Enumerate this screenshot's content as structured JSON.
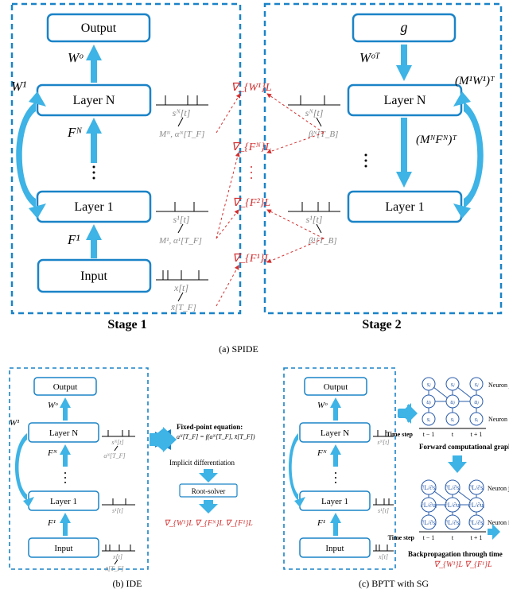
{
  "a": {
    "caption": "(a) SPIDE",
    "stage1_label": "Stage 1",
    "stage2_label": "Stage 2",
    "left": {
      "output": "Output",
      "layerN": "Layer N",
      "layer1": "Layer 1",
      "input": "Input",
      "Wo": "Wᵒ",
      "W1": "W¹",
      "FN": "Fᴺ",
      "F1": "F¹"
    },
    "right": {
      "g": "g",
      "layerN": "Layer N",
      "layer1": "Layer 1",
      "WoT": "Wᵒᵀ",
      "M1W1T": "(M¹W¹)ᵀ",
      "MNFNT": "(MᴺFᴺ)ᵀ"
    },
    "mid": {
      "sN": "sᴺ[t]",
      "sN_r": "sᴺ[t]",
      "MN": "Mᴺ, αᴺ[T_F]",
      "betaN": "βᴺ[T_B]",
      "s1": "s¹[t]",
      "s1_r": "s¹[t]",
      "M1": "M¹, α¹[T_F]",
      "beta1": "β¹[T_B]",
      "xt": "x[t]",
      "xbar": "x̄[T_F]"
    },
    "grad": {
      "W1": "∇_{W¹}L",
      "FN": "∇_{Fᴺ}L",
      "F2": "∇_{F²}L",
      "F1": "∇_{F¹}L"
    }
  },
  "b": {
    "caption": "(b) IDE",
    "output": "Output",
    "layerN": "Layer N",
    "layer1": "Layer 1",
    "input": "Input",
    "Wo": "Wᵒ",
    "W1": "W¹",
    "FN": "Fᴺ",
    "F1": "F¹",
    "fpe_title": "Fixed-point equation:",
    "fpe_eq": "aᴺ[T_F] = f(aᴺ[T_F], x̄[T_F])",
    "impdiff": "Implicit differentiation",
    "root": "Root-solver",
    "sN": "sᴺ[t]",
    "aN": "aᴺ[T_F]",
    "s1": "s¹[t]",
    "xt": "x[t]",
    "xbar": "x̄[T_F]",
    "grads": "∇_{W¹}L  ∇_{Fᴺ}L  ∇_{F¹}L"
  },
  "c": {
    "caption": "(c) BPTT with SG",
    "output": "Output",
    "layerN": "Layer N",
    "layer1": "Layer 1",
    "input": "Input",
    "Wo": "Wᵒ",
    "FN": "Fᴺ",
    "F1": "F¹",
    "sN": "sᴺ[t]",
    "s1": "s¹[t]",
    "xt": "x[t]",
    "fw_title": "Forward computational graph",
    "bw_title": "Backpropagation through time",
    "neuron_j": "Neuron j",
    "neuron_i": "Neuron i",
    "timestep": "Time step",
    "tminus1": "t − 1",
    "t": "t",
    "tplus1": "t + 1",
    "sj": "sⱼ",
    "uj": "uⱼ",
    "si": "sᵢ",
    "dsj": "∂L/∂sⱼ",
    "duj": "∂L/∂uⱼ",
    "dsi": "∂L/∂sᵢ",
    "grads": "∇_{W¹}L ∇_{F¹}L"
  }
}
